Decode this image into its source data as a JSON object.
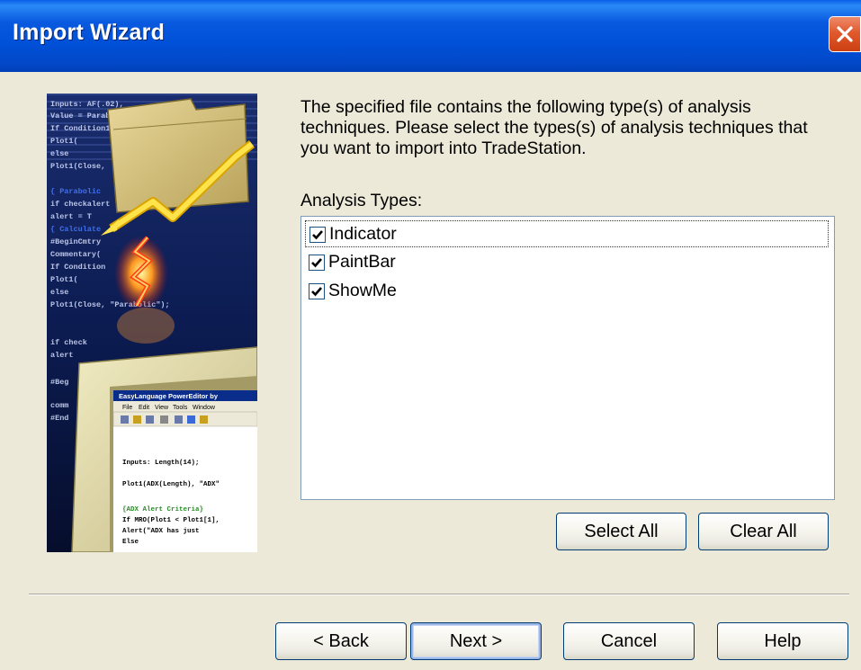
{
  "window": {
    "title": "Import Wizard"
  },
  "description": "The specified file contains the following type(s) of analysis techniques.  Please select the types(s) of analysis techniques that you want to import into TradeStation.",
  "analysis_types": {
    "label": "Analysis Types:",
    "items": [
      {
        "label": "Indicator",
        "checked": true
      },
      {
        "label": "PaintBar",
        "checked": true
      },
      {
        "label": "ShowMe",
        "checked": true
      }
    ]
  },
  "buttons": {
    "select_all": "Select All",
    "clear_all": "Clear All",
    "back": "< Back",
    "next": "Next >",
    "cancel": "Cancel",
    "help": "Help"
  },
  "illustration": {
    "editor_title": "EasyLanguage PowerEditor by",
    "menu": [
      "File",
      "Edit",
      "View",
      "Tools",
      "Window"
    ],
    "code_lines": [
      "Inputs: Length(14);",
      "Plot1(ADX(Length), \"ADX\"",
      "{ADX Alert Criteria}",
      "If MRO(Plot1 < Plot1[1],",
      "   Alert(\"ADX has just",
      "Else"
    ],
    "bg_code_lines": [
      "Inputs: AF(.02),",
      "Value = Parabolic( AF );",
      "If Condition1",
      "Plot1(",
      "else",
      "Plot1(Close,",
      "{ Parabolic",
      "if checkalert",
      "alert = T",
      "{ Calculate",
      "#BeginCmtry",
      "Commentary(",
      "If Condition",
      "Plot1(",
      "else",
      "Plot1(Close, \"Parabolic\");",
      "if check",
      "alert",
      "#Beg",
      "comm",
      "#End"
    ]
  },
  "colors": {
    "titlebar": "#0054e3",
    "dialog_bg": "#ece9d8",
    "close_button": "#e05a2e",
    "checkbox_border": "#1c5180",
    "button_border": "#003c74"
  }
}
